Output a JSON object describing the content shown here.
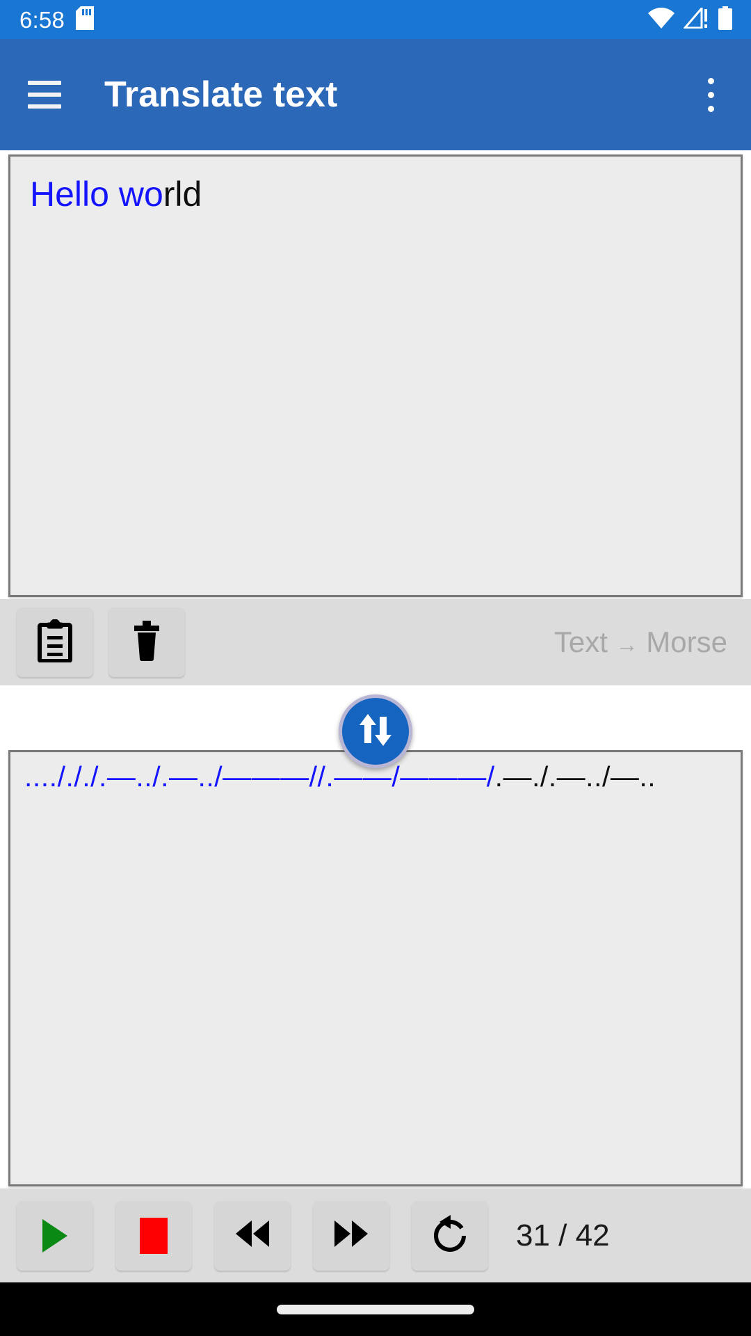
{
  "status_bar": {
    "clock": "6:58",
    "icons": [
      "sd-card-icon",
      "wifi-icon",
      "signal-no-sim-icon",
      "battery-full-icon"
    ],
    "background": "#1976d2"
  },
  "app_bar": {
    "menu_icon": "hamburger-menu-icon",
    "title": "Translate text",
    "overflow_icon": "overflow-menu-icon",
    "background": "#2c68b8"
  },
  "input_panel": {
    "text": "Hello world",
    "highlighted_prefix": "Hello wo",
    "remaining_text": "rld",
    "highlight_color": "#1414ff",
    "text_color": "#101010"
  },
  "source_toolbar": {
    "paste_label": "paste-icon",
    "clear_label": "delete-icon",
    "direction_from": "Text",
    "direction_arrow": "→",
    "direction_to": "Morse",
    "direction_full": "Text → Morse",
    "direction_color": "#a8a8a8"
  },
  "swap_button": {
    "icon": "swap-vertical-icon",
    "color": "#1565c0",
    "ring_color": "#b8b6d4"
  },
  "output_panel": {
    "morse": "..../././.—../.—../———//.——/———/.—./.—../—..",
    "highlighted_prefix": "..../././.—../.—../———//.——/———/",
    "remaining_text": ".—./.—../—..",
    "highlight_color": "#1414ff",
    "text_color": "#101010"
  },
  "playback_bar": {
    "play_label": "play-icon",
    "stop_label": "stop-icon",
    "rewind_label": "rewind-icon",
    "forward_label": "fast-forward-icon",
    "replay_label": "replay-icon",
    "counter": "31 / 42",
    "play_color": "#0a8a14",
    "stop_color": "#fe0000"
  },
  "nav_bar": {
    "handle": "gesture-nav-handle"
  }
}
